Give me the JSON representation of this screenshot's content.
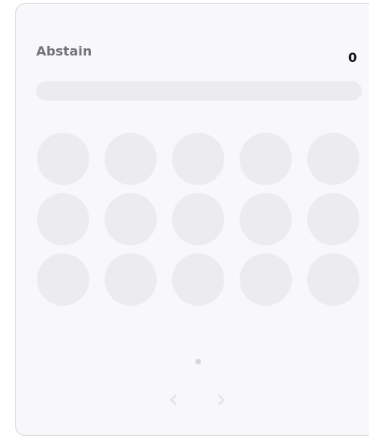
{
  "poll_option": {
    "label": "Abstain",
    "count": "0",
    "progress_fraction": 0
  },
  "voter_slots": {
    "rows": 3,
    "columns": 5,
    "filled": 0
  },
  "pagination": {
    "current_page": 1,
    "total_pages": 1,
    "previous_icon": "chevron-left-icon",
    "next_icon": "chevron-right-icon"
  },
  "colors": {
    "card_background": "#f8f8fa",
    "card_border": "#d9d9de",
    "placeholder": "#ececf0",
    "label": "#72727a",
    "count": "#111111",
    "pagination_dot": "#d6d6dc",
    "arrow": "#e2e2e6"
  }
}
